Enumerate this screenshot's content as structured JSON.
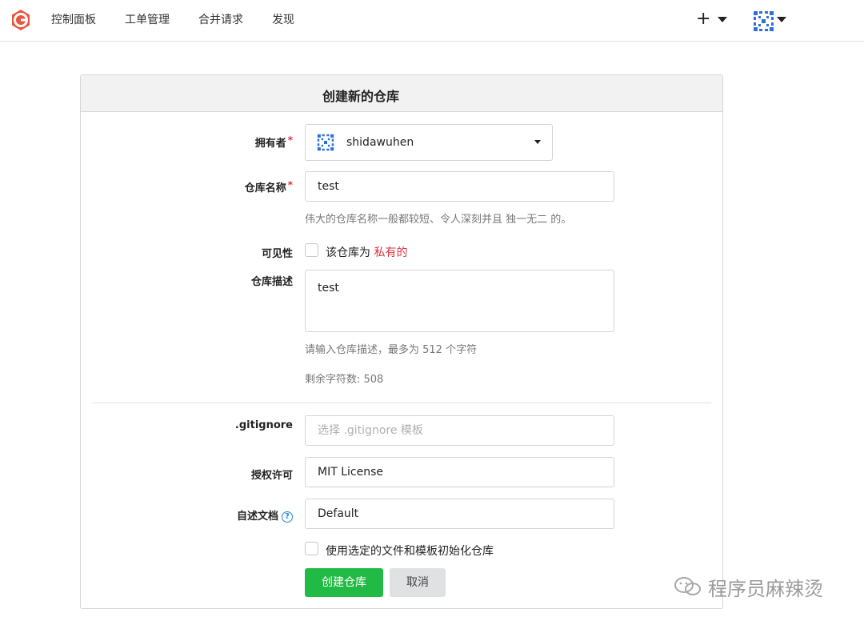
{
  "nav": {
    "items": [
      {
        "label": "控制面板"
      },
      {
        "label": "工单管理"
      },
      {
        "label": "合并请求"
      },
      {
        "label": "发现"
      }
    ],
    "plus_symbol": "+"
  },
  "colors": {
    "accent_green": "#21ba45",
    "logo_orange": "#e8553d",
    "required_red": "#d9363e",
    "link_blue": "#2185d0"
  },
  "form": {
    "title": "创建新的仓库",
    "owner": {
      "label": "拥有者",
      "required_mark": "*",
      "value": "shidawuhen"
    },
    "repo_name": {
      "label": "仓库名称",
      "required_mark": "*",
      "value": "test",
      "hint": "伟大的仓库名称一般都较短、令人深刻并且 独一无二 的。"
    },
    "visibility": {
      "label": "可见性",
      "checkbox_text": "该仓库为 ",
      "checkbox_highlight": "私有的"
    },
    "description": {
      "label": "仓库描述",
      "value": "test",
      "hint": "请输入仓库描述，最多为 512 个字符",
      "remaining": "剩余字符数: 508"
    },
    "gitignore": {
      "label": ".gitignore",
      "placeholder": "选择 .gitignore 模板"
    },
    "license": {
      "label": "授权许可",
      "value": "MIT License"
    },
    "readme": {
      "label": "自述文档",
      "help_symbol": "?",
      "value": "Default"
    },
    "init_checkbox_text": "使用选定的文件和模板初始化仓库",
    "create_button": "创建仓库",
    "cancel_button": "取消"
  },
  "watermark": {
    "text": "程序员麻辣烫",
    "icon": "wechat-icon"
  }
}
